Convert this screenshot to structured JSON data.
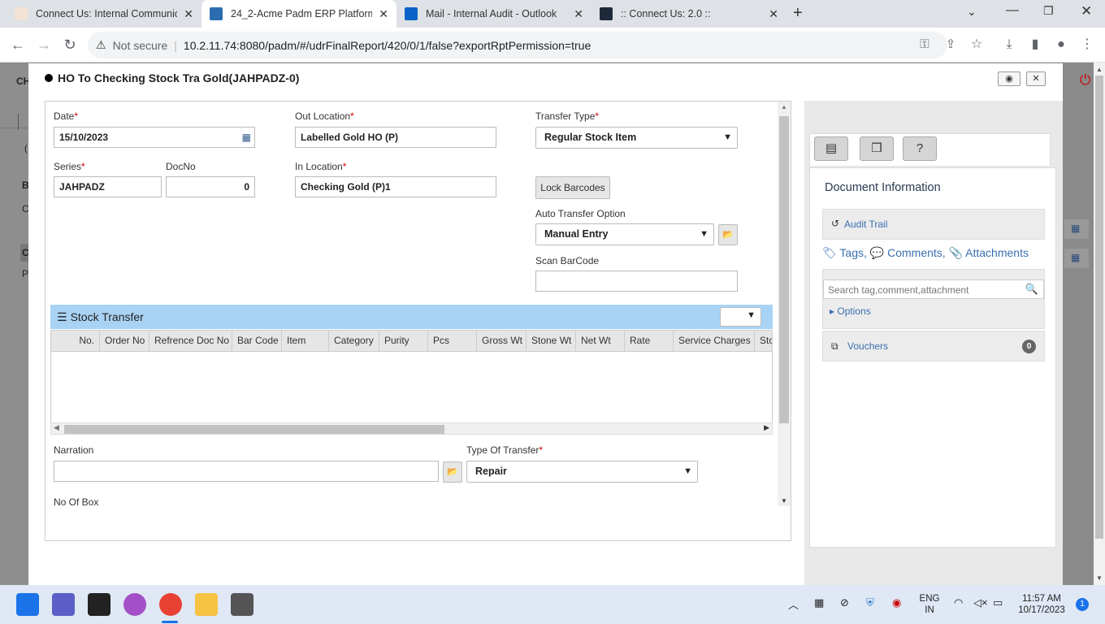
{
  "browser": {
    "tabs": [
      {
        "title": "Connect Us: Internal Communica",
        "active": false
      },
      {
        "title": "24_2-Acme Padm ERP Platform",
        "active": true
      },
      {
        "title": "Mail - Internal Audit - Outlook",
        "active": false
      },
      {
        "title": ":: Connect Us: 2.0 ::",
        "active": false
      }
    ],
    "security_label": "Not secure",
    "url": "10.2.11.74:8080/padm/#/udrFinalReport/420/0/1/false?exportRptPermission=true"
  },
  "modal": {
    "title": "HO To Checking Stock Tra Gold(JAHPADZ-0)"
  },
  "form": {
    "date_label": "Date",
    "date_value": "15/10/2023",
    "out_location_label": "Out Location",
    "out_location_value": "Labelled Gold HO (P)",
    "transfer_type_label": "Transfer Type",
    "transfer_type_value": "Regular Stock Item",
    "series_label": "Series",
    "series_value": "JAHPADZ",
    "docno_label": "DocNo",
    "docno_value": "0",
    "in_location_label": "In Location",
    "in_location_value": "Checking Gold (P)1",
    "lock_barcodes_label": "Lock Barcodes",
    "auto_transfer_label": "Auto Transfer Option",
    "auto_transfer_value": "Manual Entry",
    "scan_barcode_label": "Scan BarCode",
    "scan_barcode_value": "",
    "required_mark": "*"
  },
  "stock_transfer": {
    "title": "Stock Transfer",
    "columns": [
      "No.",
      "Order No",
      "Refrence Doc No",
      "Bar Code",
      "Item",
      "Category",
      "Purity",
      "Pcs",
      "Gross Wt",
      "Stone Wt",
      "Net Wt",
      "Rate",
      "Service Charges",
      "Stc"
    ]
  },
  "footer_form": {
    "narration_label": "Narration",
    "narration_value": "",
    "type_of_transfer_label": "Type Of Transfer",
    "type_of_transfer_value": "Repair",
    "no_of_box_label": "No Of Box"
  },
  "sidebar": {
    "doc_info_title": "Document Information",
    "audit_trail": "Audit Trail",
    "tags": "Tags,",
    "comments": "Comments,",
    "attachments": "Attachments",
    "search_placeholder": "Search tag,comment,attachment",
    "options": "Options",
    "vouchers": "Vouchers",
    "vouchers_count": "0"
  },
  "background_fragments": {
    "ch": "CH",
    "b": "B",
    "c1": "C",
    "c2": "C",
    "p": "P",
    "paren": "("
  },
  "taskbar": {
    "lang_line1": "ENG",
    "lang_line2": "IN",
    "time": "11:57 AM",
    "date": "10/17/2023",
    "notification_count": "1"
  },
  "colors": {
    "section_header": "#a9d3f5",
    "link": "#3a6fb0",
    "required": "#cc0000"
  }
}
